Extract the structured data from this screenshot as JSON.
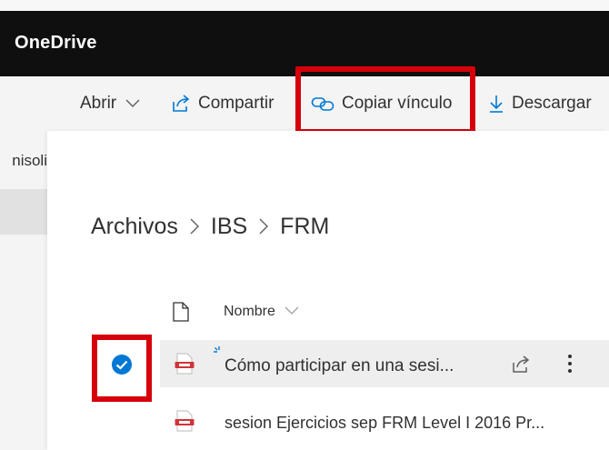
{
  "app": {
    "title": "OneDrive"
  },
  "toolbar": {
    "open_label": "Abrir",
    "share_label": "Compartir",
    "copy_link_label": "Copiar vínculo",
    "download_label": "Descargar"
  },
  "leftnav": {
    "partial_item_label": "nisoli"
  },
  "breadcrumb": [
    "Archivos",
    "IBS",
    "FRM"
  ],
  "list": {
    "name_header": "Nombre",
    "files": [
      {
        "name": "Cómo participar en una sesi...",
        "selected": true,
        "type": "pdf"
      },
      {
        "name": "sesion Ejercicios sep FRM Level I 2016 Pr...",
        "selected": false,
        "type": "pdf"
      }
    ]
  },
  "colors": {
    "appbar": "#0f0f0f",
    "accent": "#0078d4",
    "highlight": "#d6000b",
    "pdf": "#d13438"
  }
}
